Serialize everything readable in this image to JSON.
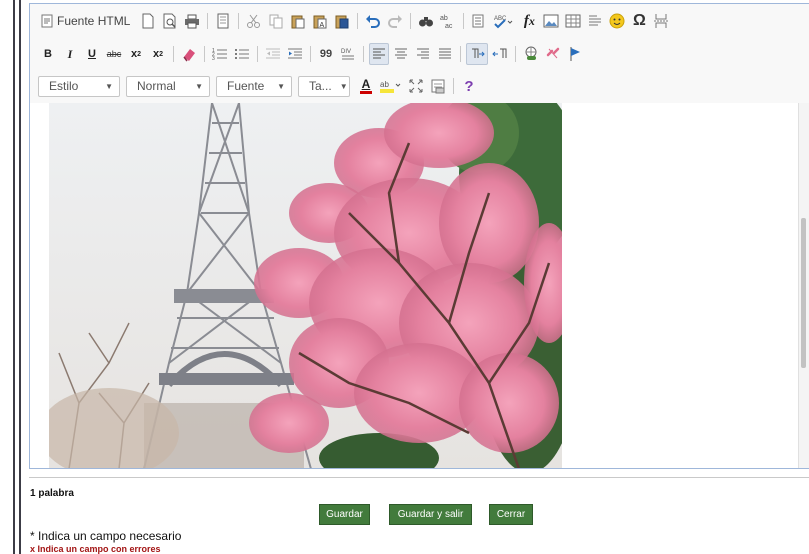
{
  "toolbar": {
    "row1": {
      "source_label": "Fuente HTML",
      "icons": [
        "new-page-icon",
        "preview-icon",
        "print-icon",
        "templates-icon",
        "cut-icon",
        "copy-icon",
        "paste-icon",
        "paste-text-icon",
        "paste-word-icon",
        "undo-icon",
        "redo-icon",
        "find-icon",
        "replace-icon",
        "select-all-icon",
        "spellcheck-icon",
        "formula-icon",
        "image-icon",
        "table-icon",
        "horizontal-rule-icon",
        "smiley-icon",
        "special-char-icon",
        "page-break-icon"
      ]
    },
    "row2": {
      "bold": "B",
      "italic": "I",
      "underline": "U",
      "strike": "abc",
      "subscript": "x",
      "superscript": "x",
      "quote": "99"
    },
    "row3": {
      "style_combo": "Estilo",
      "format_combo": "Normal",
      "font_combo": "Fuente",
      "size_combo": "Ta...",
      "text_color": "A",
      "help": "?"
    }
  },
  "footer": {
    "word_count": "1 palabra",
    "save_label": "Guardar",
    "save_exit_label": "Guardar y salir",
    "close_label": "Cerrar",
    "required_note": "* Indica un campo necesario",
    "error_note": "x Indica un campo con errores"
  },
  "colors": {
    "button_green": "#427b3c",
    "editor_border": "#9fb7da",
    "error_red": "#a31515"
  }
}
